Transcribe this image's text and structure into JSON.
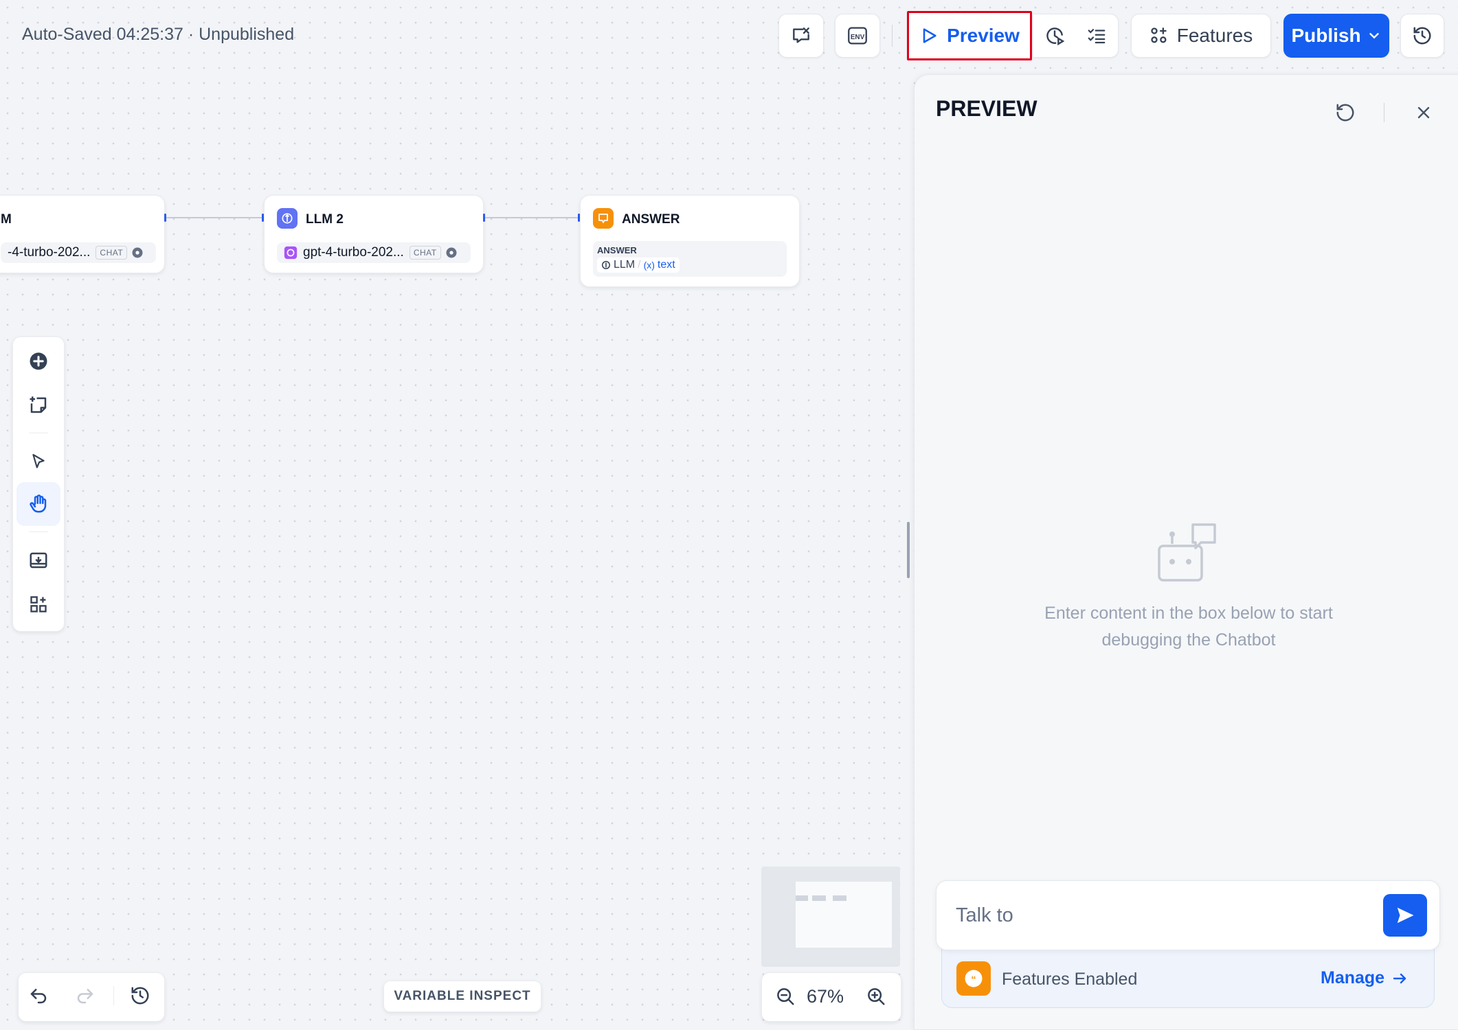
{
  "header": {
    "status": "Auto-Saved 04:25:37 · Unpublished",
    "preview_label": "Preview",
    "features_label": "Features",
    "publish_label": "Publish"
  },
  "nodes": {
    "llm1": {
      "title": "M",
      "model": "-4-turbo-202...",
      "tag": "CHAT"
    },
    "llm2": {
      "title": "LLM 2",
      "model": "gpt-4-turbo-202...",
      "tag": "CHAT"
    },
    "answer": {
      "title": "ANSWER",
      "field_label": "ANSWER",
      "ref_node": "LLM",
      "ref_sep": "/",
      "ref_var": "text"
    }
  },
  "canvas": {
    "variable_inspect": "VARIABLE INSPECT",
    "zoom": "67%"
  },
  "preview": {
    "title": "PREVIEW",
    "empty_line1": "Enter content in the box below to start",
    "empty_line2": "debugging the Chatbot",
    "input_placeholder": "Talk to",
    "features_enabled": "Features Enabled",
    "manage_label": "Manage"
  },
  "colors": {
    "accent": "#155eef",
    "highlight_border": "#e0001b",
    "answer_icon": "#f79009",
    "llm_icon": "#6172f3"
  }
}
